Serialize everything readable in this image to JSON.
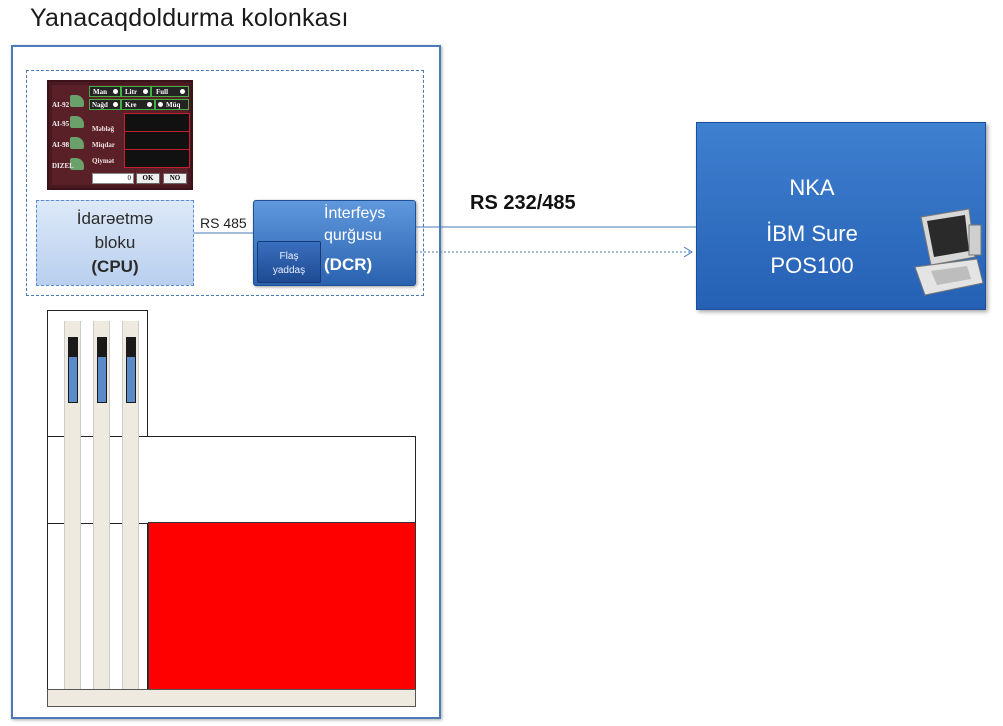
{
  "title": "Yanacaqdoldurma kolonkası",
  "display_panel": {
    "fuels": [
      "AI-92",
      "AI-95",
      "AI-98",
      "DIZEL"
    ],
    "mode_row1": [
      "Man",
      "Litr",
      "Full"
    ],
    "mode_row2": [
      "Nağd",
      "Kre",
      "Müq"
    ],
    "fields": [
      "Məbləğ",
      "Miqdar",
      "Qiymət"
    ],
    "counter_value": "0",
    "ok_label": "OK",
    "no_label": "NO"
  },
  "cpu": {
    "line1": "İdarəetmə",
    "line2": "bloku",
    "line3": "(CPU)"
  },
  "rs485_label": "RS 485",
  "dcr": {
    "line1": "İnterfeys",
    "line2": "qurğusu",
    "line3": "(DCR)",
    "flash_line1": "Flaş",
    "flash_line2": "yaddaş"
  },
  "link_label": "RS 232/485",
  "nka": {
    "line1": "NKA",
    "line2": "İBM Sure",
    "line3": "POS100"
  },
  "colors": {
    "frame": "#4a7bb7",
    "box_blue": "#2b62b0",
    "tank_red": "#ff0000"
  },
  "icons": [
    "pos-terminal-icon"
  ]
}
